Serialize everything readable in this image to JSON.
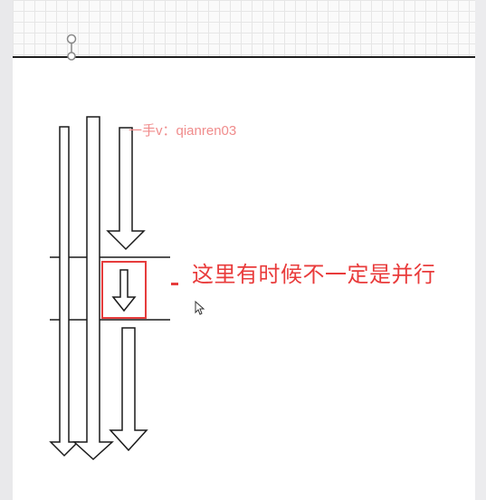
{
  "watermark": "一手v：qianren03",
  "annotation": "这里有时候不一定是并行",
  "colors": {
    "highlight": "#e63c3c",
    "arrow_stroke": "#1a1a1a",
    "watermark": "#f08c8c"
  },
  "icons": {
    "cursor": "mouse-pointer-icon"
  }
}
